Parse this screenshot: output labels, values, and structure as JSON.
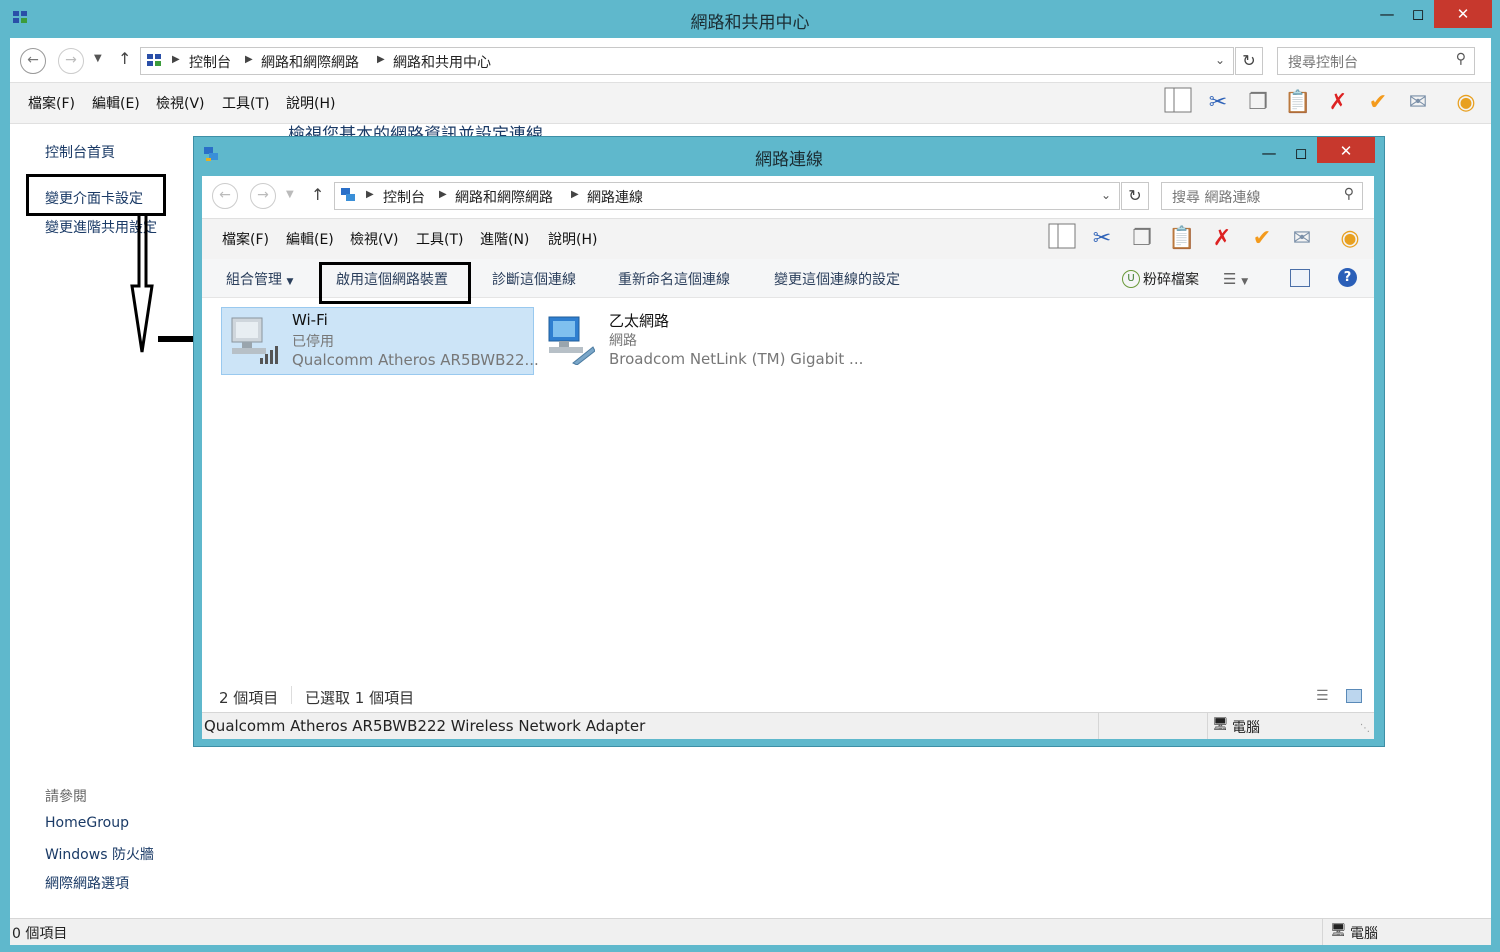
{
  "outer": {
    "title": "網路和共用中心",
    "breadcrumb": [
      "控制台",
      "網路和網際網路",
      "網路和共用中心"
    ],
    "search_placeholder": "搜尋控制台",
    "menu": [
      "檔案(F)",
      "編輯(E)",
      "檢視(V)",
      "工具(T)",
      "說明(H)"
    ],
    "heading_partial": "檢視您基本的網路資訊並設定連線",
    "sidebar": {
      "links": [
        "控制台首頁",
        "變更介面卡設定",
        "變更進階共用設定"
      ],
      "see_also_label": "請參閱",
      "see_also": [
        "HomeGroup",
        "Windows 防火牆",
        "網際網路選項"
      ]
    },
    "status_left": "0 個項目",
    "status_right": "電腦"
  },
  "inner": {
    "title": "網路連線",
    "breadcrumb": [
      "控制台",
      "網路和網際網路",
      "網路連線"
    ],
    "search_placeholder": "搜尋 網路連線",
    "menu": [
      "檔案(F)",
      "編輯(E)",
      "檢視(V)",
      "工具(T)",
      "進階(N)",
      "說明(H)"
    ],
    "commands": {
      "organize": "組合管理",
      "enable": "啟用這個網路裝置",
      "diagnose": "診斷這個連線",
      "rename": "重新命名這個連線",
      "change_settings": "變更這個連線的設定",
      "shred": "粉碎檔案"
    },
    "items": [
      {
        "name": "Wi-Fi",
        "status": "已停用",
        "device": "Qualcomm Atheros AR5BWB22..."
      },
      {
        "name": "乙太網路",
        "status": "網路",
        "device": "Broadcom NetLink (TM) Gigabit ..."
      }
    ],
    "count_text": "2 個項目",
    "selected_text": "已選取 1 個項目",
    "status_device": "Qualcomm Atheros AR5BWB222 Wireless Network Adapter",
    "status_right": "電腦"
  },
  "colors": {
    "titlebar": "#5fb8cc",
    "close": "#c7382d",
    "selection": "#cce4f7"
  }
}
